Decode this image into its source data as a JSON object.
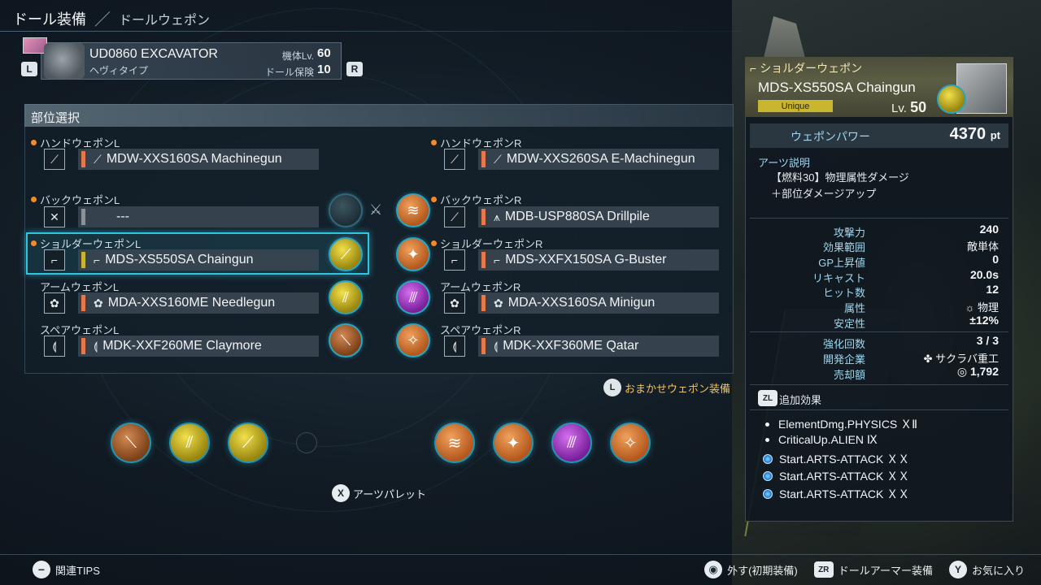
{
  "header": {
    "title": "ドール装備",
    "separator": "／",
    "subtitle": "ドールウェポン"
  },
  "doll": {
    "name": "UD0860 EXCAVATOR",
    "type": "ヘヴィタイプ",
    "level_label": "機体Lv.",
    "level_value": "60",
    "insurance_label": "ドール保険",
    "insurance_value": "10",
    "prev_button": "L",
    "next_button": "R"
  },
  "parts": {
    "title": "部位選択",
    "slots": [
      {
        "label": "ハンドウェポンL",
        "weapon": "MDW-XXS160SA Machinegun",
        "icon": "machinegun-icon",
        "bar_color": "#e8784a",
        "dot": true
      },
      {
        "label": "ハンドウェポンR",
        "weapon": "MDW-XXS260SA E-Machinegun",
        "icon": "machinegun-icon",
        "bar_color": "#e8784a",
        "dot": true
      },
      {
        "label": "バックウェポンL",
        "weapon": "---",
        "icon": "back-weapon-icon",
        "bar_color": "#8a9298",
        "dot": true
      },
      {
        "label": "バックウェポンR",
        "weapon": "MDB-USP880SA Drillpile",
        "icon": "drill-icon",
        "bar_color": "#e8784a",
        "dot": true
      },
      {
        "label": "ショルダーウェポンL",
        "weapon": "MDS-XS550SA Chaingun",
        "icon": "shoulder-gun-icon",
        "bar_color": "#c9b52e",
        "dot": true
      },
      {
        "label": "ショルダーウェポンR",
        "weapon": "MDS-XXFX150SA G-Buster",
        "icon": "shoulder-gun-icon",
        "bar_color": "#e8784a",
        "dot": true
      },
      {
        "label": "アームウェポンL",
        "weapon": "MDA-XXS160ME Needlegun",
        "icon": "arm-weapon-icon",
        "bar_color": "#e8784a",
        "dot": false
      },
      {
        "label": "アームウェポンR",
        "weapon": "MDA-XXS160SA Minigun",
        "icon": "arm-weapon-icon",
        "bar_color": "#e8784a",
        "dot": false
      },
      {
        "label": "スペアウェポンL",
        "weapon": "MDK-XXF260ME Claymore",
        "icon": "spare-weapon-icon",
        "bar_color": "#e8784a",
        "dot": false
      },
      {
        "label": "スペアウェポンR",
        "weapon": "MDK-XXF360ME Qatar",
        "icon": "spare-weapon-icon",
        "bar_color": "#e8784a",
        "dot": false
      }
    ],
    "selected_slot": "ショルダーウェポンL"
  },
  "auto_equip": {
    "label": "おまかせウェポン装備",
    "button": "L"
  },
  "arts_palette": {
    "label": "アーツパレット",
    "button": "X"
  },
  "detail": {
    "category": "ショルダーウェポン",
    "name": "MDS-XS550SA Chaingun",
    "rarity": "Unique",
    "level_label": "Lv.",
    "level_value": "50",
    "power_label": "ウェポンパワー",
    "power_value": "4370",
    "power_unit": "pt",
    "desc_title": "アーツ説明",
    "desc_line1": "【燃料30】物理属性ダメージ",
    "desc_line2": "＋部位ダメージアップ",
    "stats": [
      {
        "label": "攻撃力",
        "value": "240"
      },
      {
        "label": "効果範囲",
        "value": "敵単体"
      },
      {
        "label": "GP上昇値",
        "value": "0"
      },
      {
        "label": "リキャスト",
        "value": "20.0s"
      },
      {
        "label": "ヒット数",
        "value": "12"
      },
      {
        "label": "属性",
        "value": "☼ 物理"
      },
      {
        "label": "安定性",
        "value": "±12%"
      }
    ],
    "stats2": [
      {
        "label": "強化回数",
        "value": "3 / 3"
      },
      {
        "label": "開発企業",
        "value": "サクラバ重工"
      },
      {
        "label": "売却額",
        "value": "1,792"
      }
    ],
    "extra_button": "ZL",
    "extra_title": "追加効果",
    "extra_effects": [
      {
        "text": "ElementDmg.PHYSICS ＸⅡ",
        "type": "white"
      },
      {
        "text": "CriticalUp.ALIEN Ⅸ",
        "type": "white"
      },
      {
        "text": "Start.ARTS-ATTACK ＸＸ",
        "type": "blue"
      },
      {
        "text": "Start.ARTS-ATTACK ＸＸ",
        "type": "blue"
      },
      {
        "text": "Start.ARTS-ATTACK ＸＸ",
        "type": "blue"
      }
    ]
  },
  "footer": {
    "tips": "関連TIPS",
    "unequip": "外す(初期装備)",
    "armor": "ドールアーマー装備",
    "favorite": "お気に入り",
    "zr": "ZR",
    "y": "Y"
  }
}
